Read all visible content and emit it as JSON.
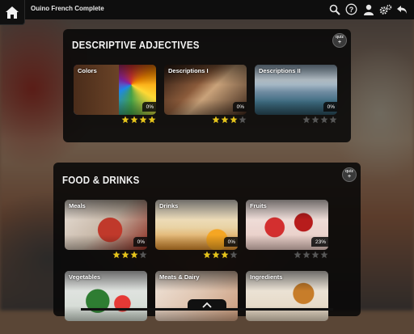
{
  "app": {
    "title": "Ouino French Complete"
  },
  "topbar": {
    "icons": [
      "search-icon",
      "help-icon",
      "user-icon",
      "settings-icon",
      "back-icon"
    ]
  },
  "sections": [
    {
      "title": "DESCRIPTIVE ADJECTIVES",
      "quiz_label": "quiz",
      "cards": [
        {
          "label": "Colors",
          "progress": "0%",
          "stars_filled": 4,
          "stars_total": 4
        },
        {
          "label": "Descriptions I",
          "progress": "0%",
          "stars_filled": 3,
          "stars_total": 4
        },
        {
          "label": "Descriptions II",
          "progress": "0%",
          "stars_filled": 0,
          "stars_total": 4
        }
      ]
    },
    {
      "title": "FOOD & DRINKS",
      "quiz_label": "quiz",
      "cards": [
        {
          "label": "Meals",
          "progress": "0%",
          "stars_filled": 3,
          "stars_total": 4
        },
        {
          "label": "Drinks",
          "progress": "0%",
          "stars_filled": 3,
          "stars_total": 4
        },
        {
          "label": "Fruits",
          "progress": "23%",
          "stars_filled": 0,
          "stars_total": 4
        },
        {
          "label": "Vegetables"
        },
        {
          "label": "Meats & Dairy"
        },
        {
          "label": "Ingredients"
        }
      ]
    }
  ],
  "colors": {
    "star_filled": "#e3c21b",
    "star_empty": "#555555",
    "panel": "#0a0a0a"
  }
}
